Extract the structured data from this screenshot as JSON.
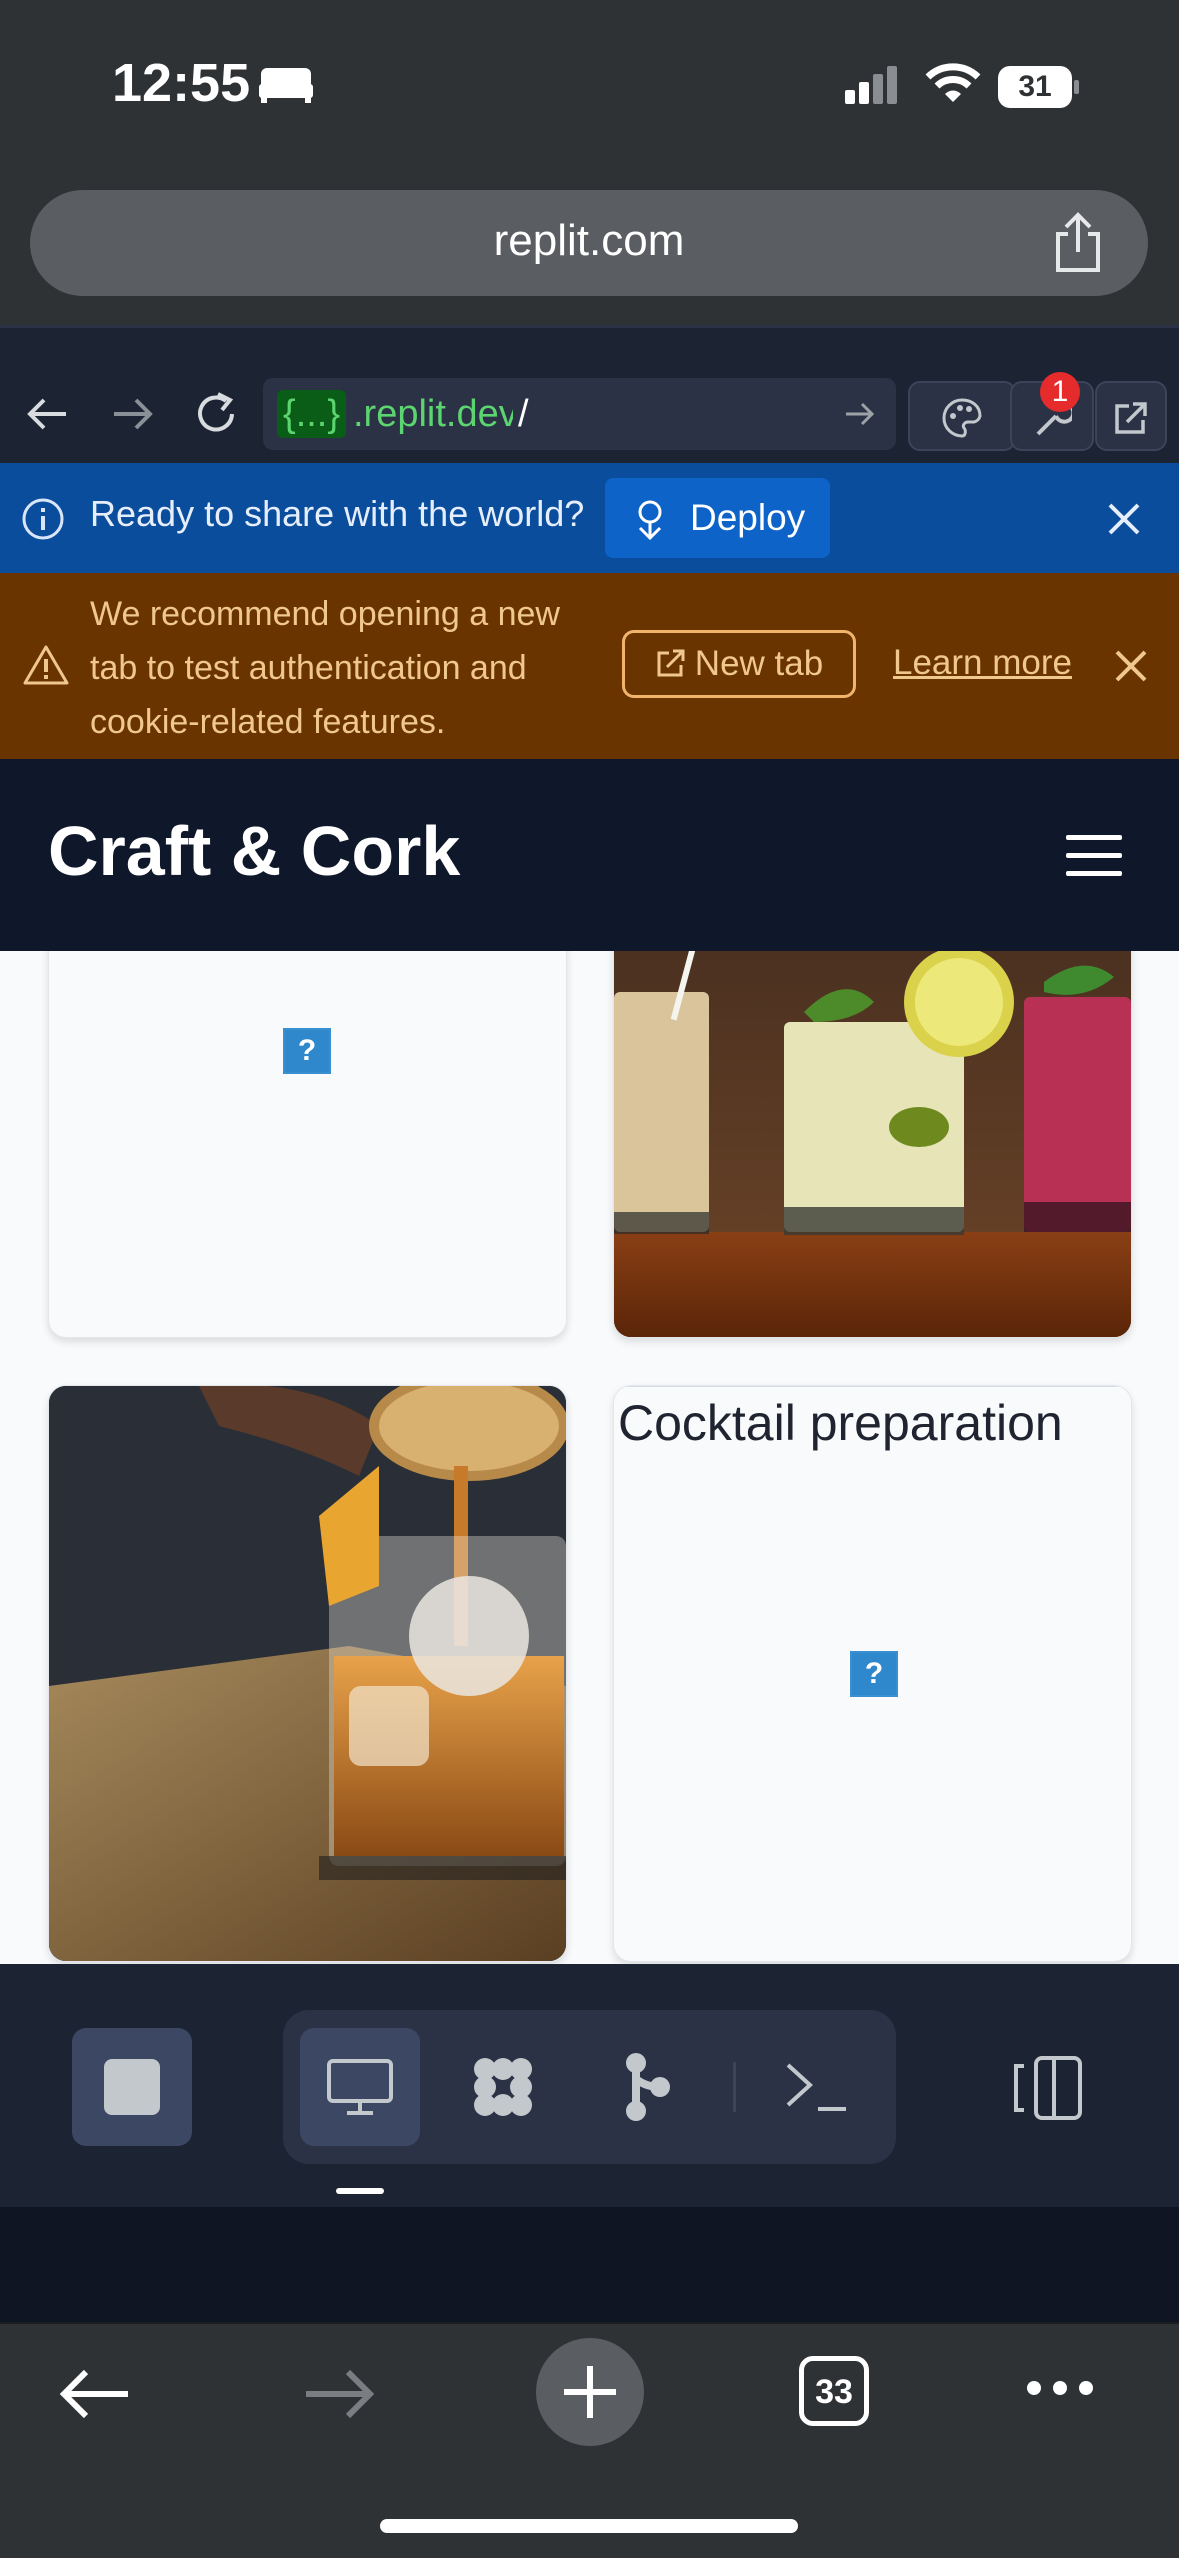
{
  "status_bar": {
    "time": "12:55",
    "battery": "31"
  },
  "safari": {
    "url": "replit.com"
  },
  "replit_toolbar": {
    "address_tag": "{...}",
    "address_host": ".replit.dev",
    "address_path": "/",
    "notification_count": "1"
  },
  "deploy_banner": {
    "text": "Ready to share with the world?",
    "button_label": "Deploy"
  },
  "warning_banner": {
    "text": "We recommend opening a new tab to test authentication and cookie-related features.",
    "new_tab_label": "New tab",
    "learn_more_label": "Learn more"
  },
  "site": {
    "brand": "Craft & Cork",
    "cards": [
      {
        "caption": "",
        "image": "broken"
      },
      {
        "caption": "",
        "image": "cocktails-on-bar"
      },
      {
        "caption": "",
        "image": "pouring-whiskey"
      },
      {
        "caption": "Cocktail preparation",
        "image": "broken"
      }
    ]
  },
  "broken_image_glyph": "?",
  "safari_bottom": {
    "tab_count": "33"
  },
  "colors": {
    "deploy_bg": "#0a4d9c",
    "warning_bg": "#6a3400",
    "site_header_bg": "#0f172a",
    "replit_bg": "#1c2333"
  }
}
